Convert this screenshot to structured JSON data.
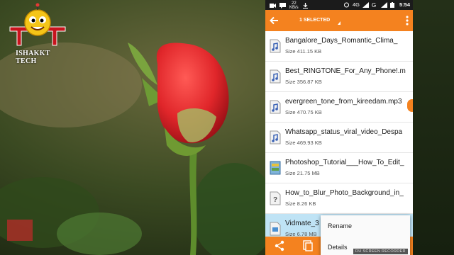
{
  "overlay": {
    "channel_text": "ISHAKKT TECH",
    "watermark": "DU SCREEN RECORDER"
  },
  "statusbar": {
    "data_speed": "22\nKB/s",
    "network": "4G",
    "time": "5:54"
  },
  "appbar": {
    "selection_label": "1 SELECTED"
  },
  "files": [
    {
      "name": "Bangalore_Days_Romantic_Clima_",
      "size": "Size 411.15 KB",
      "icon": "audio-file-icon",
      "selected": false
    },
    {
      "name": "Best_RINGTONE_For_Any_Phone!.m",
      "size": "Size 356.87 KB",
      "icon": "audio-file-icon",
      "selected": false
    },
    {
      "name": "evergreen_tone_from_kireedam.mp3",
      "size": "Size 470.75 KB",
      "icon": "audio-file-icon",
      "selected": false
    },
    {
      "name": "Whatsapp_status_viral_video_Despa",
      "size": "Size 469.93 KB",
      "icon": "audio-file-icon",
      "selected": false
    },
    {
      "name": "Photoshop_Tutorial___How_To_Edit_",
      "size": "Size 21.75 MB",
      "icon": "archive-file-icon",
      "selected": false
    },
    {
      "name": "How_to_Blur_Photo_Background_in_",
      "size": "Size 8.26 KB",
      "icon": "unknown-file-icon",
      "selected": false
    },
    {
      "name": "Vidmate_3",
      "size": "Size 6.78 MB",
      "icon": "apk-file-icon",
      "selected": true
    }
  ],
  "context_menu": {
    "items": [
      "Rename",
      "Details"
    ]
  },
  "colors": {
    "accent": "#f4821f",
    "selected_row": "#bfe3f5"
  }
}
